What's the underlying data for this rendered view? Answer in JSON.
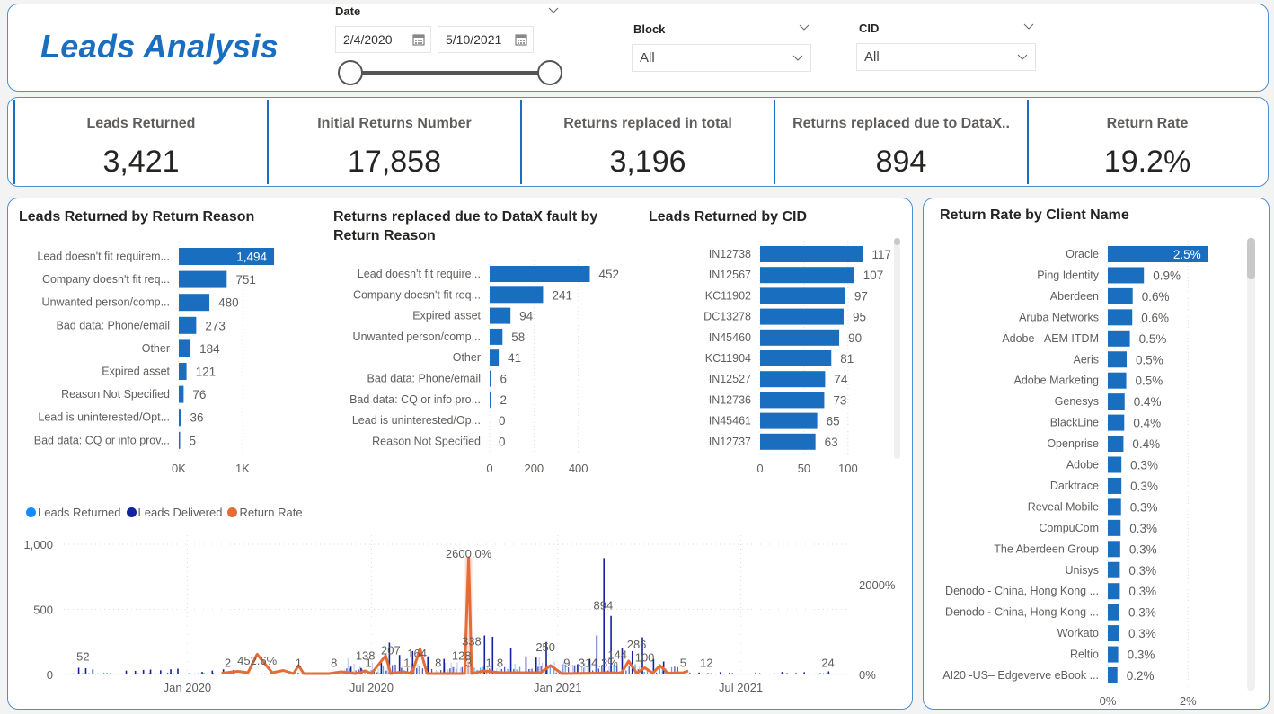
{
  "header": {
    "title": "Leads Analysis",
    "date_slicer": {
      "label": "Date",
      "start": "2/4/2020",
      "end": "5/10/2021",
      "range_start_fraction": 0,
      "range_end_fraction": 1
    },
    "block_slicer": {
      "label": "Block",
      "value": "All"
    },
    "cid_slicer": {
      "label": "CID",
      "value": "All"
    }
  },
  "kpis": [
    {
      "label": "Leads Returned",
      "value": "3,421"
    },
    {
      "label": "Initial Returns Number",
      "value": "17,858"
    },
    {
      "label": "Returns replaced in total",
      "value": "3,196"
    },
    {
      "label": "Returns replaced due to DataX..",
      "value": "894"
    },
    {
      "label": "Return Rate",
      "value": "19.2%"
    }
  ],
  "colors": {
    "bar": "#1a6ec0",
    "accent": "#1a6ec0",
    "returned": "#118dff",
    "delivered": "#12239e",
    "rate": "#e66c37"
  },
  "chart_data": [
    {
      "id": "by_reason",
      "type": "bar",
      "orientation": "horizontal",
      "title": "Leads Returned by Return Reason",
      "categories": [
        "Lead doesn't fit requirem...",
        "Company doesn't fit req...",
        "Unwanted person/comp...",
        "Bad data: Phone/email",
        "Other",
        "Expired asset",
        "Reason Not Specified",
        "Lead is uninterested/Opt...",
        "Bad data: CQ or info prov..."
      ],
      "values": [
        1494,
        751,
        480,
        273,
        184,
        121,
        76,
        36,
        5
      ],
      "labels": [
        "1,494",
        "751",
        "480",
        "273",
        "184",
        "121",
        "76",
        "36",
        "5"
      ],
      "xlim": [
        0,
        2000
      ],
      "xticks": [
        {
          "v": 0,
          "label": "0K"
        },
        {
          "v": 1000,
          "label": "1K"
        }
      ],
      "inside_label_first": true
    },
    {
      "id": "replaced_by_reason",
      "type": "bar",
      "orientation": "horizontal",
      "title": "Returns replaced due to DataX fault by Return Reason",
      "categories": [
        "Lead doesn't fit require...",
        "Company doesn't fit req...",
        "Expired asset",
        "Unwanted person/comp...",
        "Other",
        "Bad data: Phone/email",
        "Bad data: CQ or info pro...",
        "Lead is uninterested/Op...",
        "Reason Not Specified"
      ],
      "values": [
        452,
        241,
        94,
        58,
        41,
        6,
        2,
        0,
        0
      ],
      "labels": [
        "452",
        "241",
        "94",
        "58",
        "41",
        "6",
        "2",
        "0",
        "0"
      ],
      "xlim": [
        0,
        600
      ],
      "xticks": [
        {
          "v": 0,
          "label": "0"
        },
        {
          "v": 200,
          "label": "200"
        },
        {
          "v": 400,
          "label": "400"
        }
      ],
      "inside_label_first": false
    },
    {
      "id": "by_cid",
      "type": "bar",
      "orientation": "horizontal",
      "title": "Leads Returned by CID",
      "categories": [
        "IN12738",
        "IN12567",
        "KC11902",
        "DC13278",
        "IN45460",
        "KC11904",
        "IN12527",
        "IN12736",
        "IN45461",
        "IN12737"
      ],
      "values": [
        117,
        107,
        97,
        95,
        90,
        81,
        74,
        73,
        65,
        63
      ],
      "labels": [
        "117",
        "107",
        "97",
        "95",
        "90",
        "81",
        "74",
        "73",
        "65",
        "63"
      ],
      "xlim": [
        0,
        140
      ],
      "xticks": [
        {
          "v": 0,
          "label": "0"
        },
        {
          "v": 50,
          "label": "50"
        },
        {
          "v": 100,
          "label": "100"
        }
      ],
      "inside_label_first": false
    },
    {
      "id": "rate_by_client",
      "type": "bar",
      "orientation": "horizontal",
      "title": "Return Rate by Client Name",
      "categories": [
        "Oracle",
        "Ping Identity",
        "Aberdeen",
        "Aruba Networks",
        "Adobe - AEM ITDM",
        "Aeris",
        "Adobe Marketing",
        "Genesys",
        "BlackLine",
        "Openprise",
        "Adobe",
        "Darktrace",
        "Reveal Mobile",
        "CompuCom",
        "The Aberdeen Group",
        "Unisys",
        "Denodo - China, Hong Kong ...",
        "Denodo - China, Hong Kong ...",
        "Workato",
        "Reltio",
        "AI20 -US– Edgeverve eBook ..."
      ],
      "values": [
        2.5,
        0.9,
        0.62,
        0.61,
        0.55,
        0.47,
        0.46,
        0.42,
        0.41,
        0.39,
        0.34,
        0.34,
        0.33,
        0.32,
        0.31,
        0.3,
        0.3,
        0.29,
        0.29,
        0.26,
        0.24
      ],
      "labels": [
        "2.5%",
        "0.9%",
        "0.6%",
        "0.6%",
        "0.5%",
        "0.5%",
        "0.5%",
        "0.4%",
        "0.4%",
        "0.4%",
        "0.3%",
        "0.3%",
        "0.3%",
        "0.3%",
        "0.3%",
        "0.3%",
        "0.3%",
        "0.3%",
        "0.3%",
        "0.3%",
        "0.2%"
      ],
      "xlim": [
        0,
        3
      ],
      "xticks": [
        {
          "v": 0,
          "label": "0%"
        },
        {
          "v": 2,
          "label": "2%"
        }
      ],
      "inside_label_first": true
    },
    {
      "id": "timeline",
      "type": "line",
      "legend": [
        "Leads Returned",
        "Leads Delivered",
        "Return Rate"
      ],
      "legend_position": "top-left",
      "xlim": [
        "2019-09-01",
        "2021-10-15"
      ],
      "xticks": [
        {
          "date": "2020-01-01",
          "label": "Jan 2020"
        },
        {
          "date": "2020-07-01",
          "label": "Jul 2020"
        },
        {
          "date": "2021-01-01",
          "label": "Jan 2021"
        },
        {
          "date": "2021-07-01",
          "label": "Jul 2021"
        }
      ],
      "ylim_left": [
        0,
        1000
      ],
      "yticks_left": [
        {
          "v": 0,
          "label": "0"
        },
        {
          "v": 500,
          "label": "500"
        },
        {
          "v": 1000,
          "label": "1,000"
        }
      ],
      "ylim_right": [
        0,
        2900
      ],
      "yticks_right": [
        {
          "v": 0,
          "label": "0%"
        },
        {
          "v": 2000,
          "label": "2000%"
        }
      ],
      "annotations": [
        {
          "date": "2019-09-20",
          "value": 52,
          "label": "52"
        },
        {
          "date": "2020-02-10",
          "value": 2,
          "label": "2"
        },
        {
          "date": "2020-03-10",
          "value": 20,
          "label": "452.6%"
        },
        {
          "date": "2020-04-20",
          "value": 2,
          "label": "1"
        },
        {
          "date": "2020-05-25",
          "value": 2,
          "label": "8"
        },
        {
          "date": "2020-06-25",
          "value": 60,
          "label": "138"
        },
        {
          "date": "2020-06-28",
          "value": 2,
          "label": "1"
        },
        {
          "date": "2020-07-20",
          "value": 100,
          "label": "207"
        },
        {
          "date": "2020-08-05",
          "value": 2,
          "label": "1"
        },
        {
          "date": "2020-08-15",
          "value": 75,
          "label": "164"
        },
        {
          "date": "2020-09-05",
          "value": 2,
          "label": "8"
        },
        {
          "date": "2020-09-28",
          "value": 60,
          "label": "128"
        },
        {
          "date": "2020-10-05",
          "value": 2,
          "label": "3"
        },
        {
          "date": "2020-10-08",
          "value": 170,
          "label": "338"
        },
        {
          "date": "2020-10-05",
          "value": 840,
          "label": "2600.0%"
        },
        {
          "date": "2020-10-25",
          "value": 2,
          "label": "1"
        },
        {
          "date": "2020-11-05",
          "value": 2,
          "label": "8"
        },
        {
          "date": "2020-12-20",
          "value": 125,
          "label": "250"
        },
        {
          "date": "2021-01-10",
          "value": 2,
          "label": "9"
        },
        {
          "date": "2021-02-15",
          "value": 445,
          "label": "894"
        },
        {
          "date": "2021-02-10",
          "value": 2,
          "label": "314.3%"
        },
        {
          "date": "2021-03-01",
          "value": 65,
          "label": "144"
        },
        {
          "date": "2021-03-20",
          "value": 145,
          "label": "286"
        },
        {
          "date": "2021-03-28",
          "value": 45,
          "label": "100"
        },
        {
          "date": "2021-05-05",
          "value": 2,
          "label": "5"
        },
        {
          "date": "2021-05-28",
          "value": 2,
          "label": "12"
        },
        {
          "date": "2021-09-25",
          "value": 2,
          "label": "24"
        }
      ],
      "delivered_spikes": [
        [
          "2019-09-15",
          52
        ],
        [
          "2019-09-22",
          48
        ],
        [
          "2019-09-29",
          40
        ],
        [
          "2019-11-01",
          30
        ],
        [
          "2019-11-10",
          28
        ],
        [
          "2019-11-18",
          35
        ],
        [
          "2019-11-25",
          38
        ],
        [
          "2019-12-05",
          32
        ],
        [
          "2019-12-15",
          40
        ],
        [
          "2019-12-22",
          45
        ],
        [
          "2020-01-15",
          20
        ],
        [
          "2020-01-25",
          30
        ],
        [
          "2020-02-05",
          40
        ],
        [
          "2020-02-15",
          35
        ],
        [
          "2020-06-10",
          60
        ],
        [
          "2020-06-20",
          50
        ],
        [
          "2020-07-10",
          90
        ],
        [
          "2020-07-18",
          245
        ],
        [
          "2020-07-28",
          150
        ],
        [
          "2020-08-10",
          180
        ],
        [
          "2020-08-25",
          140
        ],
        [
          "2020-09-10",
          120
        ],
        [
          "2020-10-20",
          300
        ],
        [
          "2020-10-28",
          290
        ],
        [
          "2020-11-15",
          200
        ],
        [
          "2020-11-30",
          140
        ],
        [
          "2020-12-10",
          130
        ],
        [
          "2020-12-20",
          250
        ],
        [
          "2021-01-20",
          80
        ],
        [
          "2021-02-01",
          120
        ],
        [
          "2021-02-08",
          300
        ],
        [
          "2021-02-15",
          894
        ],
        [
          "2021-02-22",
          450
        ],
        [
          "2021-03-05",
          200
        ],
        [
          "2021-03-15",
          180
        ],
        [
          "2021-03-25",
          286
        ],
        [
          "2021-04-05",
          120
        ],
        [
          "2021-04-15",
          100
        ],
        [
          "2021-05-20",
          15
        ],
        [
          "2021-06-10",
          18
        ],
        [
          "2021-07-15",
          15
        ],
        [
          "2021-08-10",
          20
        ],
        [
          "2021-09-01",
          18
        ],
        [
          "2021-09-25",
          24
        ]
      ],
      "rate_points": [
        [
          "2020-02-04",
          30
        ],
        [
          "2020-02-20",
          70
        ],
        [
          "2020-03-01",
          40
        ],
        [
          "2020-03-10",
          450
        ],
        [
          "2020-03-25",
          40
        ],
        [
          "2020-04-05",
          90
        ],
        [
          "2020-04-15",
          20
        ],
        [
          "2020-04-20",
          200
        ],
        [
          "2020-04-25",
          20
        ],
        [
          "2020-05-20",
          20
        ],
        [
          "2020-06-01",
          60
        ],
        [
          "2020-06-15",
          20
        ],
        [
          "2020-06-25",
          80
        ],
        [
          "2020-07-01",
          20
        ],
        [
          "2020-07-15",
          420
        ],
        [
          "2020-07-20",
          20
        ],
        [
          "2020-08-01",
          60
        ],
        [
          "2020-08-10",
          20
        ],
        [
          "2020-08-18",
          570
        ],
        [
          "2020-08-25",
          20
        ],
        [
          "2020-09-20",
          20
        ],
        [
          "2020-10-01",
          20
        ],
        [
          "2020-10-05",
          2600
        ],
        [
          "2020-10-08",
          20
        ],
        [
          "2020-10-20",
          80
        ],
        [
          "2020-11-05",
          40
        ],
        [
          "2020-12-15",
          40
        ],
        [
          "2020-12-25",
          200
        ],
        [
          "2021-01-05",
          20
        ],
        [
          "2021-02-10",
          30
        ],
        [
          "2021-02-20",
          40
        ],
        [
          "2021-03-05",
          30
        ],
        [
          "2021-03-12",
          300
        ],
        [
          "2021-03-20",
          30
        ],
        [
          "2021-03-28",
          150
        ],
        [
          "2021-04-05",
          30
        ],
        [
          "2021-04-12",
          200
        ],
        [
          "2021-04-20",
          30
        ],
        [
          "2021-05-05",
          40
        ],
        [
          "2021-05-10",
          80
        ]
      ]
    }
  ]
}
